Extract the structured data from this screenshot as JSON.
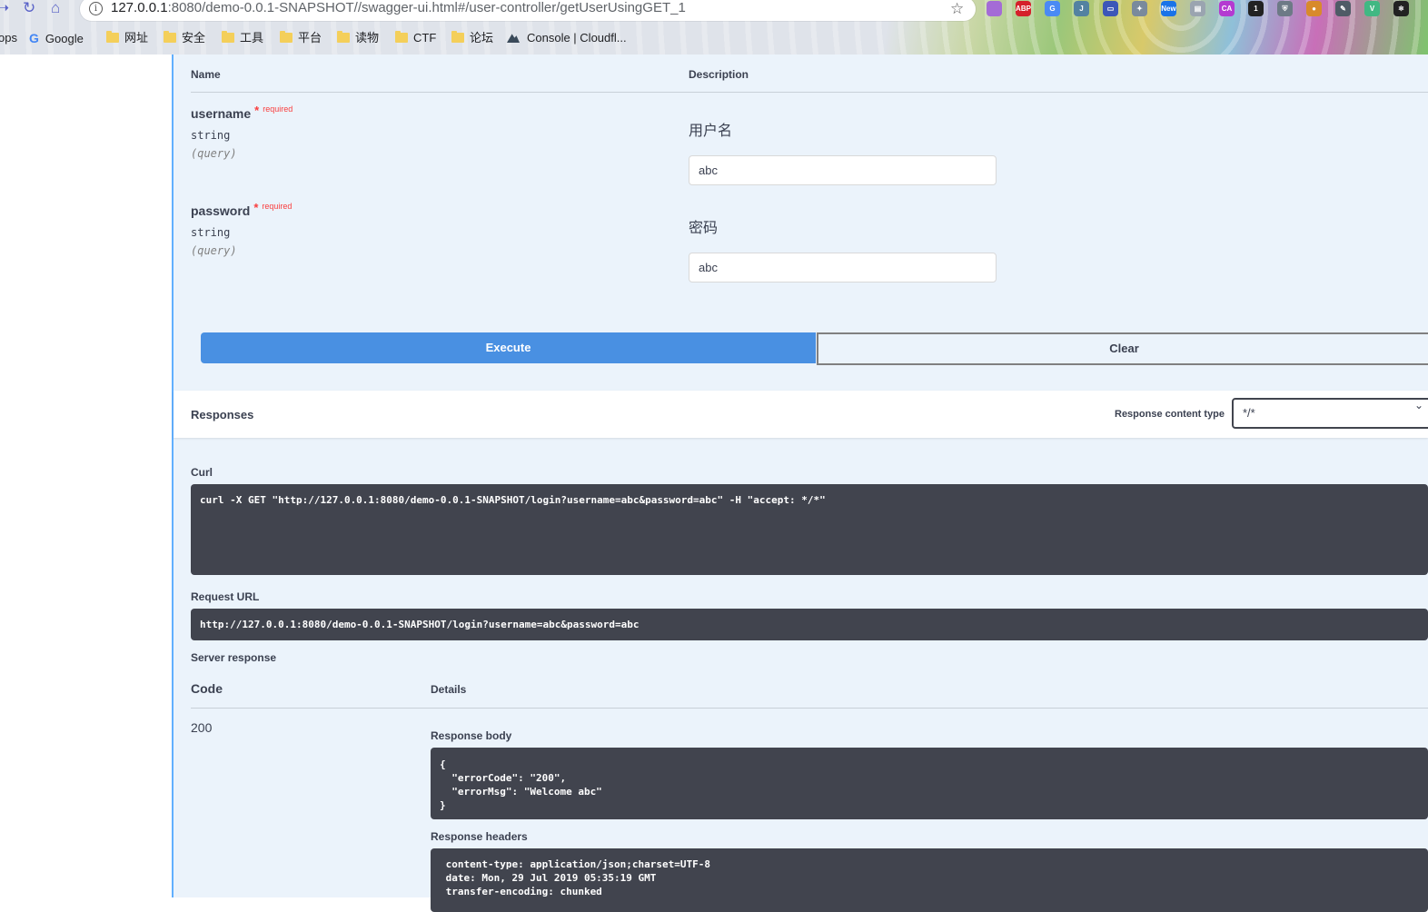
{
  "browser": {
    "url_host": "127.0.0.1",
    "url_path": ":8080/demo-0.0.1-SNAPSHOT//swagger-ui.html#/user-controller/getUserUsingGET_1",
    "extensions": [
      {
        "name": "circle-ext-icon",
        "label": "",
        "color": "#a46bd6"
      },
      {
        "name": "adblock-plus-icon",
        "label": "ABP",
        "color": "#d5202a"
      },
      {
        "name": "google-translate-icon",
        "label": "G",
        "color": "#4a8af4"
      },
      {
        "name": "java-icon",
        "label": "J",
        "color": "#5382a1"
      },
      {
        "name": "window-icon",
        "label": "▭",
        "color": "#3c57b8"
      },
      {
        "name": "puzzle-icon",
        "label": "✦",
        "color": "#7a8a9c"
      },
      {
        "name": "new-badge-icon",
        "label": "New",
        "color": "#1a73e8"
      },
      {
        "name": "card-icon",
        "label": "▤",
        "color": "#9aa4b0"
      },
      {
        "name": "ca-icon",
        "label": "CA",
        "color": "#b43ad1"
      },
      {
        "name": "notification-icon",
        "label": "1",
        "color": "#222222"
      },
      {
        "name": "shield-icon",
        "label": "⛨",
        "color": "#6d7a86"
      },
      {
        "name": "cookie-icon",
        "label": "●",
        "color": "#d88a2c"
      },
      {
        "name": "pen-icon",
        "label": "✎",
        "color": "#4f5b66"
      },
      {
        "name": "vue-icon",
        "label": "V",
        "color": "#41b883"
      },
      {
        "name": "react-icon",
        "label": "⚛",
        "color": "#222222"
      }
    ],
    "bookmarks": [
      {
        "label": "ops",
        "type": "partial"
      },
      {
        "label": "Google",
        "type": "google"
      },
      {
        "label": "网址",
        "type": "folder"
      },
      {
        "label": "安全",
        "type": "folder"
      },
      {
        "label": "工具",
        "type": "folder"
      },
      {
        "label": "平台",
        "type": "folder"
      },
      {
        "label": "读物",
        "type": "folder"
      },
      {
        "label": "CTF",
        "type": "folder"
      },
      {
        "label": "论坛",
        "type": "folder"
      },
      {
        "label": "Console | Cloudfl...",
        "type": "site"
      }
    ]
  },
  "parameters": {
    "header_name": "Name",
    "header_description": "Description",
    "items": [
      {
        "name": "username",
        "required_mark": "*",
        "required_text": "required",
        "type": "string",
        "in": "(query)",
        "description": "用户名",
        "value": "abc"
      },
      {
        "name": "password",
        "required_mark": "*",
        "required_text": "required",
        "type": "string",
        "in": "(query)",
        "description": "密码",
        "value": "abc"
      }
    ]
  },
  "buttons": {
    "execute": "Execute",
    "clear": "Clear"
  },
  "responses": {
    "title": "Responses",
    "content_type_label": "Response content type",
    "content_type_value": "*/*",
    "curl_label": "Curl",
    "curl": "curl -X GET \"http://127.0.0.1:8080/demo-0.0.1-SNAPSHOT/login?username=abc&password=abc\" -H \"accept: */*\"",
    "request_url_label": "Request URL",
    "request_url": "http://127.0.0.1:8080/demo-0.0.1-SNAPSHOT/login?username=abc&password=abc",
    "server_response_label": "Server response",
    "code_header": "Code",
    "details_header": "Details",
    "code": "200",
    "response_body_label": "Response body",
    "response_body": "{\n  \"errorCode\": \"200\",\n  \"errorMsg\": \"Welcome abc\"\n}",
    "response_headers_label": "Response headers",
    "response_headers": " content-type: application/json;charset=UTF-8\n date: Mon, 29 Jul 2019 05:35:19 GMT\n transfer-encoding: chunked"
  }
}
